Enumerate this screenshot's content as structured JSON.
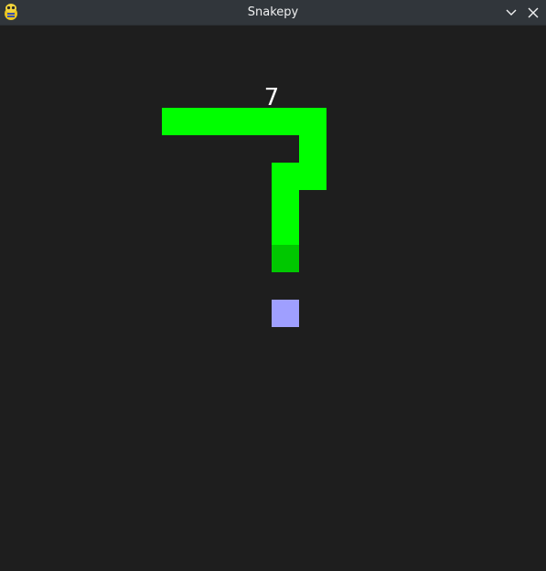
{
  "window": {
    "title": "Snakepy",
    "icon": "pygame-snake-icon",
    "buttons": [
      "minimize-chevron-icon",
      "close-icon"
    ],
    "title_color": "#eff0f1",
    "titlebar_color": "#31363b"
  },
  "game": {
    "score": "7",
    "background_color": "#1e1e1e",
    "snake_color": "#00ff00",
    "snake_tail_color": "#00c800",
    "food_color": "#9f9fff",
    "grid_columns": 20,
    "grid_rows": 20,
    "snake_segments": [
      [
        6,
        3
      ],
      [
        7,
        3
      ],
      [
        8,
        3
      ],
      [
        9,
        3
      ],
      [
        10,
        3
      ],
      [
        11,
        3
      ],
      [
        11,
        4
      ],
      [
        11,
        5
      ],
      [
        10,
        5
      ],
      [
        10,
        6
      ],
      [
        10,
        7
      ],
      [
        10,
        8
      ]
    ],
    "tail_segment_index": 11,
    "food": [
      10,
      10
    ]
  }
}
